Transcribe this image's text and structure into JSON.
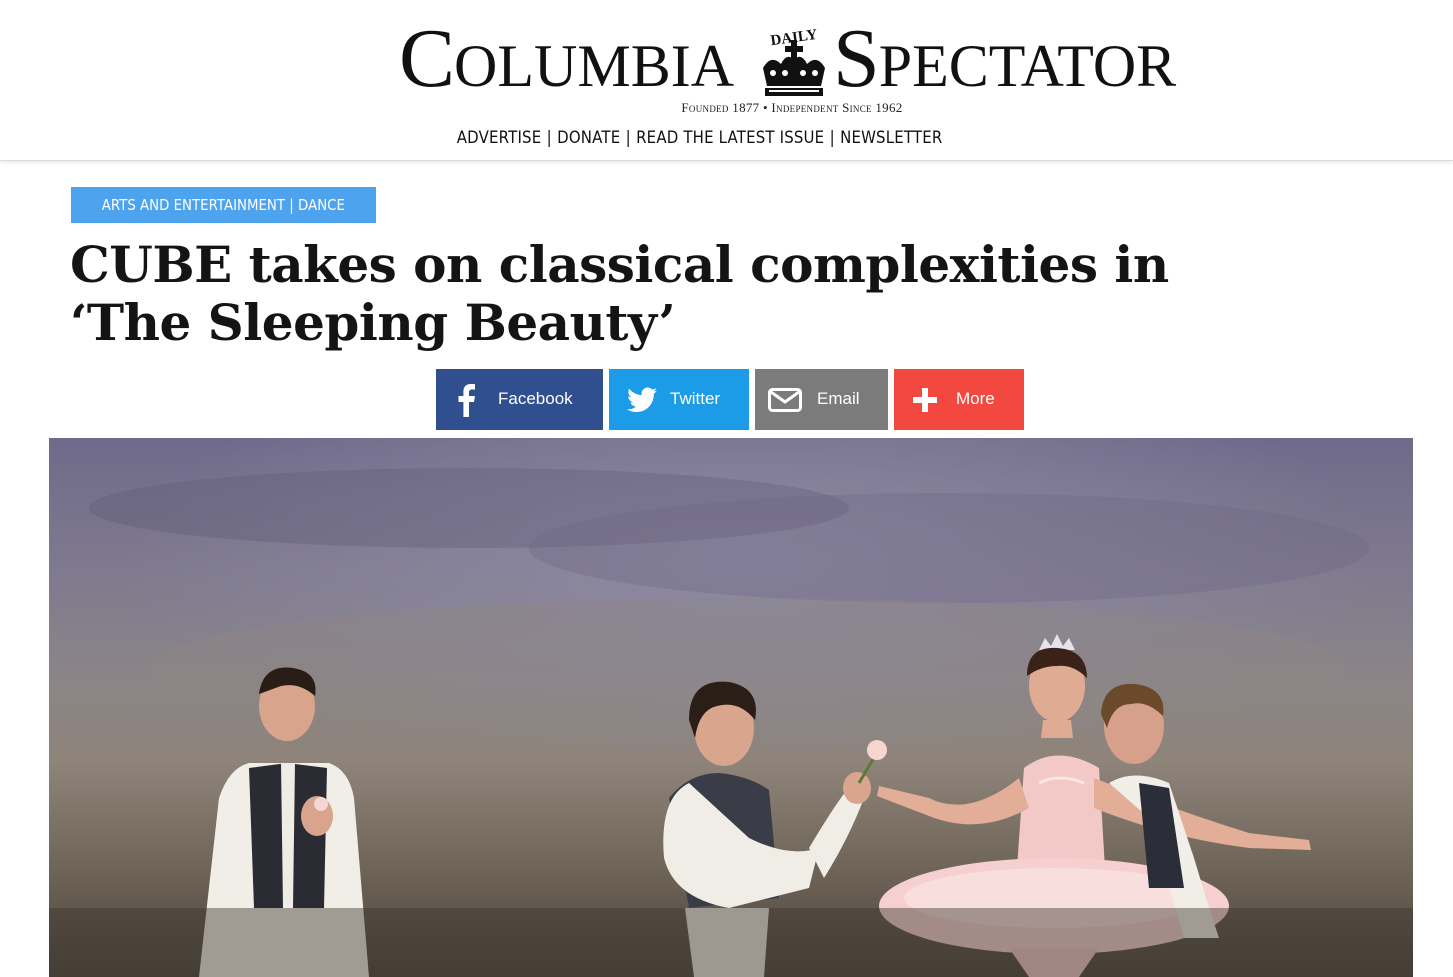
{
  "masthead": {
    "logo_left": "Columbia",
    "logo_daily": "DAILY",
    "logo_right": "Spectator",
    "tagline": "Founded 1877 • Independent Since 1962",
    "nav": [
      {
        "label": "ADVERTISE"
      },
      {
        "label": "DONATE"
      },
      {
        "label": "READ THE LATEST ISSUE"
      },
      {
        "label": "NEWSLETTER"
      }
    ],
    "nav_separator": "|"
  },
  "article": {
    "section": "ARTS AND ENTERTAINMENT",
    "subsection": "DANCE",
    "badge_separator": "|",
    "headline_line1": "CUBE takes on classical complexities in",
    "headline_line2": "‘The Sleeping Beauty’"
  },
  "share": [
    {
      "label": "Facebook",
      "icon": "facebook-icon",
      "color": "#2f4f8f"
    },
    {
      "label": "Twitter",
      "icon": "twitter-icon",
      "color": "#1c9ce6"
    },
    {
      "label": "Email",
      "icon": "email-icon",
      "color": "#7b7b7b"
    },
    {
      "label": "More",
      "icon": "plus-icon",
      "color": "#f2483f"
    }
  ],
  "colors": {
    "badge": "#4ea3ee",
    "headline": "#141414"
  }
}
